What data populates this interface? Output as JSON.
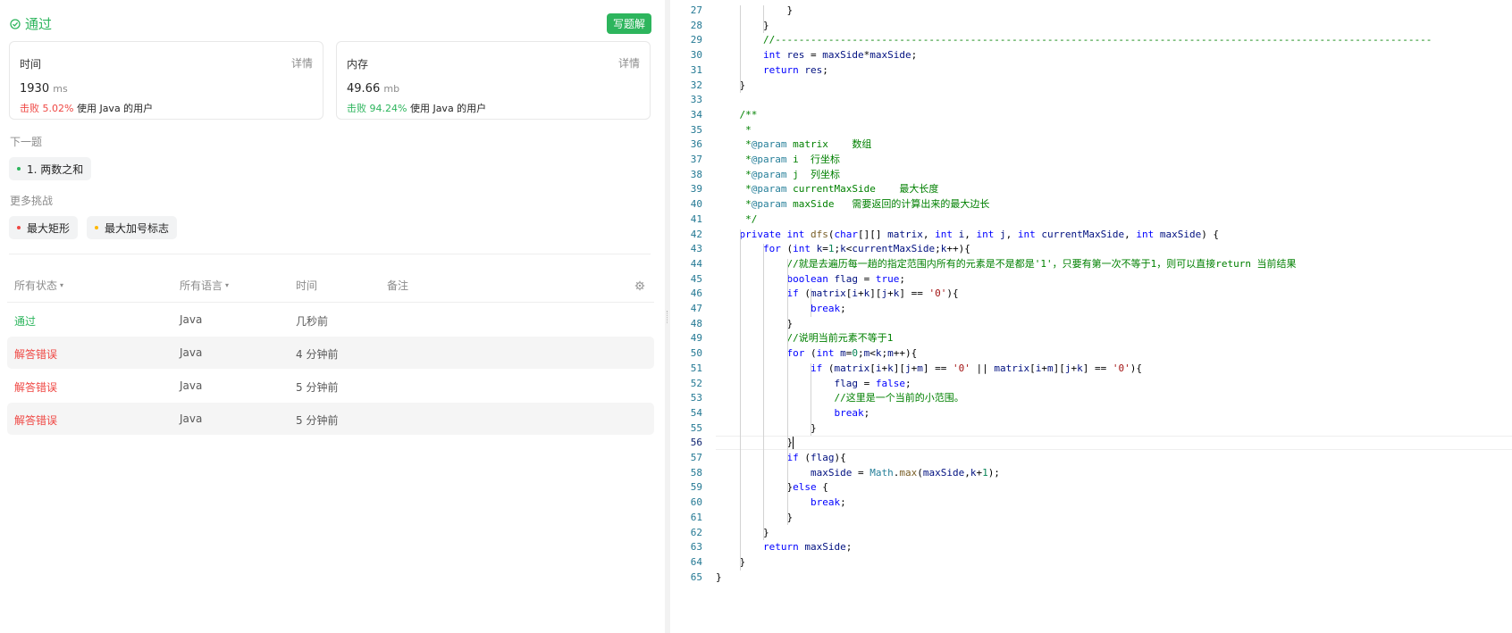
{
  "status": {
    "label": "通过"
  },
  "solution_button": "写题解",
  "cards": [
    {
      "title": "时间",
      "detail": "详情",
      "value": "1930",
      "unit": "ms",
      "beats_label": "击败",
      "beats_pct": "5.02%",
      "beats_suffix": "使用 Java 的用户",
      "tone": "red"
    },
    {
      "title": "内存",
      "detail": "详情",
      "value": "49.66",
      "unit": "mb",
      "beats_label": "击败",
      "beats_pct": "94.24%",
      "beats_suffix": "使用 Java 的用户",
      "tone": "green"
    }
  ],
  "next_problem": {
    "label": "下一题",
    "item": "1. 两数之和",
    "dot_color": "#2db55d"
  },
  "more_challenges": {
    "label": "更多挑战",
    "items": [
      {
        "text": "最大矩形",
        "dot_color": "#ef4743"
      },
      {
        "text": "最大加号标志",
        "dot_color": "#ffb800"
      }
    ]
  },
  "table": {
    "headers": {
      "status": "所有状态",
      "language": "所有语言",
      "time": "时间",
      "note": "备注"
    },
    "rows": [
      {
        "status": "通过",
        "kind": "ok",
        "language": "Java",
        "time": "几秒前"
      },
      {
        "status": "解答错误",
        "kind": "err",
        "language": "Java",
        "time": "4 分钟前"
      },
      {
        "status": "解答错误",
        "kind": "err",
        "language": "Java",
        "time": "5 分钟前"
      },
      {
        "status": "解答错误",
        "kind": "err",
        "language": "Java",
        "time": "5 分钟前"
      }
    ]
  },
  "editor": {
    "first_line": 27,
    "lines": [
      "            }",
      "        }",
      "        //---------------------------------------------------------------------------------------------------------------",
      "        int res = maxSide*maxSide;",
      "        return res;",
      "    }",
      "",
      "    /**",
      "     *",
      "     *@param matrix    数组",
      "     *@param i  行坐标",
      "     *@param j  列坐标",
      "     *@param currentMaxSide    最大长度",
      "     *@param maxSide   需要返回的计算出来的最大边长",
      "     */",
      "    private int dfs(char[][] matrix, int i, int j, int currentMaxSide, int maxSide) {",
      "        for (int k=1;k<currentMaxSide;k++){",
      "            //就是去遍历每一趟的指定范围内所有的元素是不是都是'1'，只要有第一次不等于1，则可以直接return 当前结果",
      "            boolean flag = true;",
      "            if (matrix[i+k][j+k] == '0'){",
      "                break;",
      "            }",
      "            //说明当前元素不等于1",
      "            for (int m=0;m<k;m++){",
      "                if (matrix[i+k][j+m] == '0' || matrix[i+m][j+k] == '0'){",
      "                    flag = false;",
      "                    //这里是一个当前的小范围。",
      "                    break;",
      "                }",
      "            }",
      "            if (flag){",
      "                maxSide = Math.max(maxSide,k+1);",
      "            }else {",
      "                break;",
      "            }",
      "        }",
      "        return maxSide;",
      "    }",
      "}"
    ]
  }
}
